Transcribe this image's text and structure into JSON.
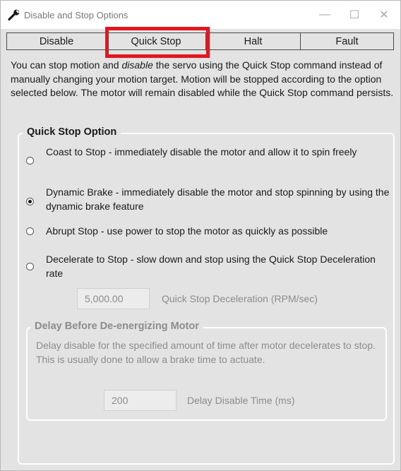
{
  "window": {
    "title": "Disable and Stop Options",
    "minimize_glyph": "—",
    "maximize_glyph": "☐",
    "close_glyph": "✕",
    "icon": "wrench-icon"
  },
  "tabs": [
    {
      "label": "Disable"
    },
    {
      "label": "Quick Stop"
    },
    {
      "label": "Halt"
    },
    {
      "label": "Fault"
    }
  ],
  "colors": {
    "highlight_box": "#e3161e",
    "background": "#e3e3e3",
    "disabled_text": "#8c8c8c"
  },
  "description": {
    "part1": "You can stop motion and ",
    "emphasis": "disable",
    "part2": " the servo using the Quick Stop command instead of manually changing your motion target. Motion will be stopped according to the option selected below. The motor will remain disabled while the Quick Stop command persists."
  },
  "quick_stop_option": {
    "title": "Quick Stop Option",
    "options": [
      {
        "label": "Coast to Stop - immediately disable the motor and allow it to spin freely",
        "checked": false
      },
      {
        "label": "Dynamic Brake - immediately disable the motor and stop spinning by using the dynamic brake feature",
        "checked": true
      },
      {
        "label": "Abrupt Stop - use power to stop the motor as quickly as possible",
        "checked": false
      },
      {
        "label": "Decelerate to Stop - slow down and stop using the Quick Stop Deceleration rate",
        "checked": false
      }
    ],
    "deceleration": {
      "value": "5,000.00",
      "label": "Quick Stop Deceleration (RPM/sec)"
    }
  },
  "delay_group": {
    "title": "Delay Before De-energizing Motor",
    "description": "Delay disable for the specified amount of time after motor decelerates to stop. This is usually done to allow a brake time to actuate.",
    "delay": {
      "value": "200",
      "label": "Delay Disable Time (ms)"
    }
  }
}
